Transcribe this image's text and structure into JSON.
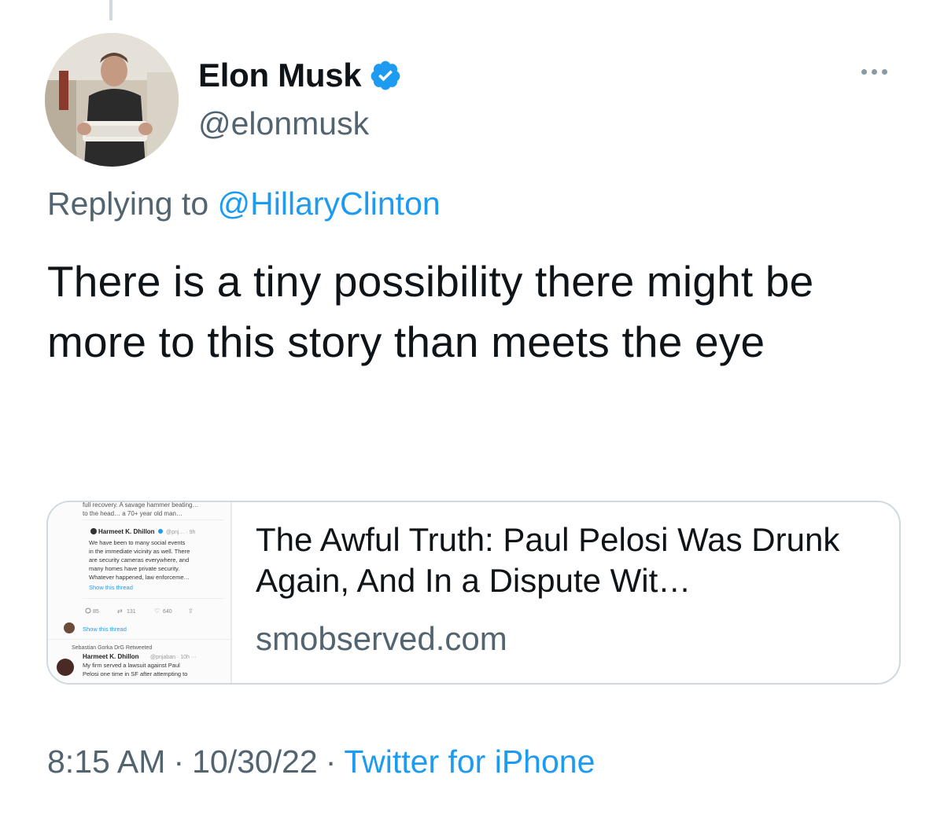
{
  "author": {
    "display_name": "Elon Musk",
    "handle": "@elonmusk",
    "verified_icon": "verified-badge-icon",
    "verified_color": "#1d9bf0"
  },
  "more_icon": "more-options-icon",
  "reply": {
    "prefix": "Replying to",
    "mention": "@HillaryClinton"
  },
  "tweet": {
    "text": "There is a tiny possibility there might be more to this story than meets the eye"
  },
  "link_card": {
    "title": "The Awful Truth: Paul Pelosi Was Drunk Again, And In a Dispute Wit…",
    "domain": "smobserved.com",
    "thumbnail": {
      "top_text_1": "full recovery. A savage hammer beating…",
      "top_text_2": "to the head… a 70+ year old man…",
      "author_1": "Harmeet K. Dhillon",
      "meta_1": "@pnj… · 9h",
      "body_1": [
        "We have been to many social events",
        "in the immediate vicinity as well. There",
        "are security cameras everywhere, and",
        "many homes have private security.",
        "Whatever happened, law enforceme…"
      ],
      "show_thread_1": "Show this thread",
      "stats": [
        "85",
        "131",
        "640"
      ],
      "show_thread_2": "Show this thread",
      "retweeted_by": "Sebastian Gorka DrG Retweeted",
      "author_2": "Harmeet K. Dhillon",
      "meta_2": "@pnjaban · 10h ···",
      "body_2": [
        "My firm served a lawsuit against Paul",
        "Pelosi one time in SF after attempting to"
      ]
    }
  },
  "footer": {
    "time": "8:15 AM",
    "date": "10/30/22",
    "source": "Twitter for iPhone",
    "separator": "·"
  },
  "colors": {
    "accent": "#1d9bf0",
    "secondary_text": "#536471",
    "primary_text": "#0f1419",
    "border": "#cfd9de"
  }
}
